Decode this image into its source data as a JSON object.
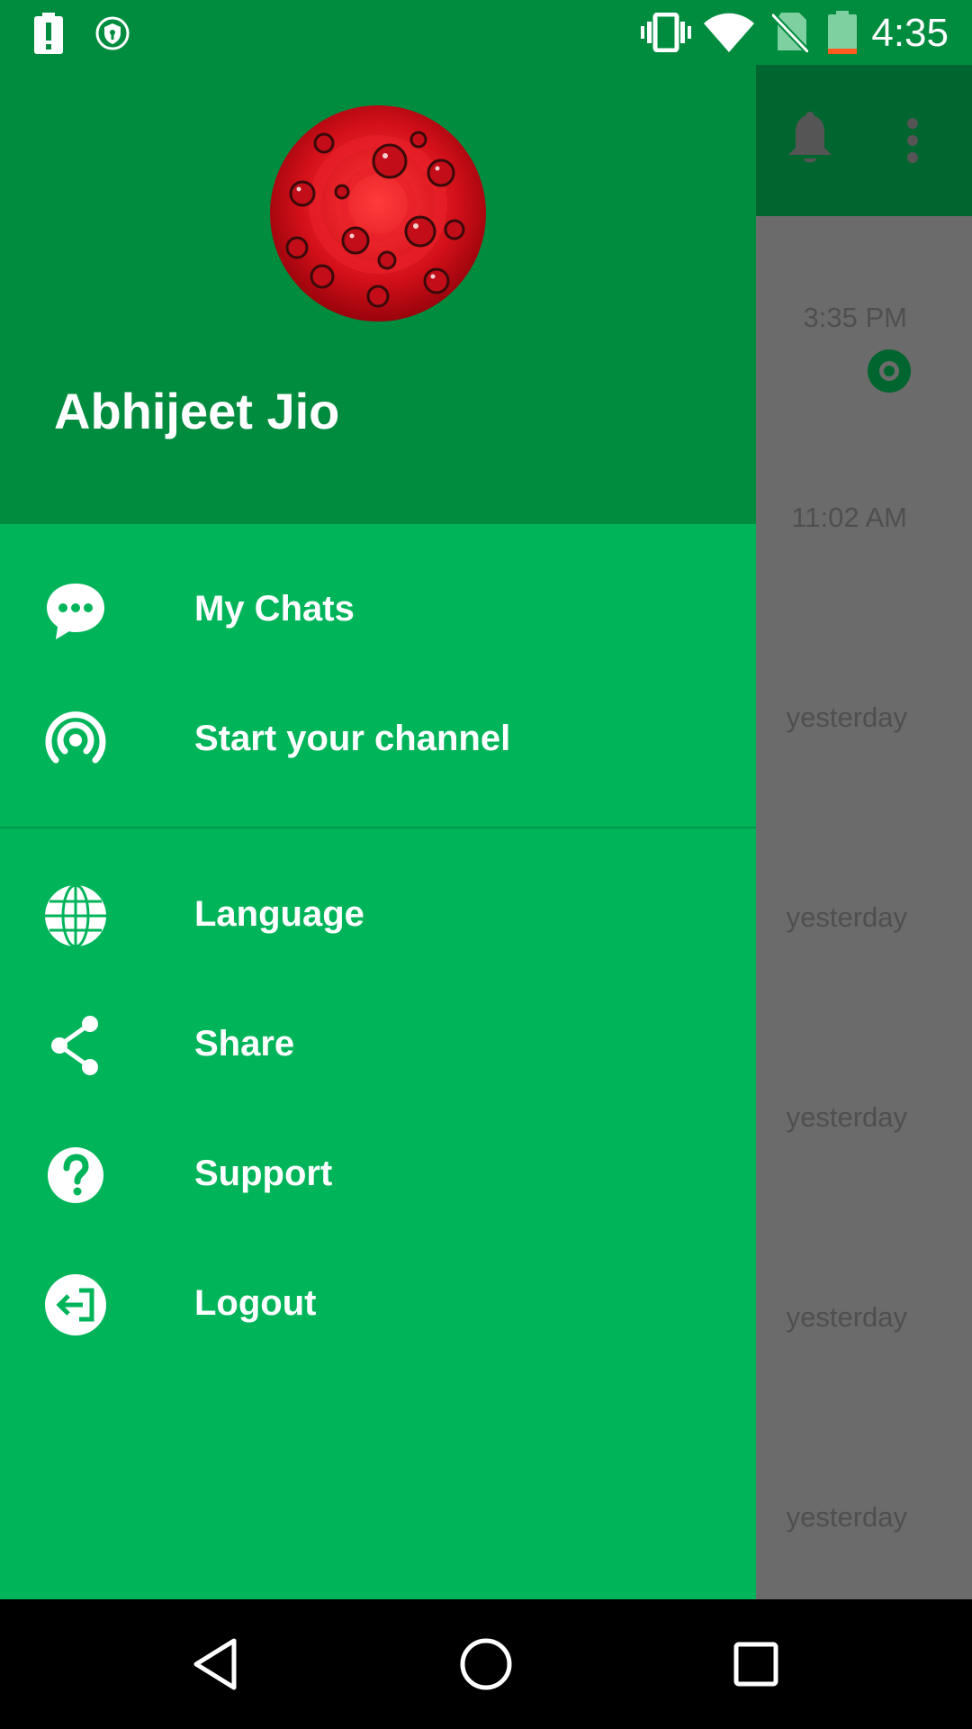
{
  "status_bar": {
    "time": "4:35",
    "icons": [
      "battery-alert-icon",
      "vpn-shield-icon",
      "vibrate-icon",
      "wifi-icon",
      "no-sim-icon",
      "battery-icon"
    ]
  },
  "background": {
    "icons": [
      "bell-icon",
      "more-vert-icon"
    ],
    "times": [
      "3:35 PM",
      "11:02 AM",
      "yesterday",
      "yesterday",
      "yesterday",
      "yesterday",
      "yesterday"
    ]
  },
  "drawer": {
    "profile_name": "Abhijeet Jio",
    "menu": [
      {
        "label": "My Chats",
        "icon": "chat-icon"
      },
      {
        "label": "Start your channel",
        "icon": "broadcast-icon"
      },
      {
        "label": "Language",
        "icon": "globe-icon"
      },
      {
        "label": "Share",
        "icon": "share-icon"
      },
      {
        "label": "Support",
        "icon": "help-icon"
      },
      {
        "label": "Logout",
        "icon": "logout-icon"
      }
    ]
  },
  "nav_bar": {
    "icons": [
      "back-icon",
      "home-icon",
      "recents-icon"
    ]
  },
  "colors": {
    "drawer": "#00b45a",
    "header": "#008c3e",
    "appbar_dimmed": "#00652e",
    "scrim": "#6b6b6b"
  }
}
